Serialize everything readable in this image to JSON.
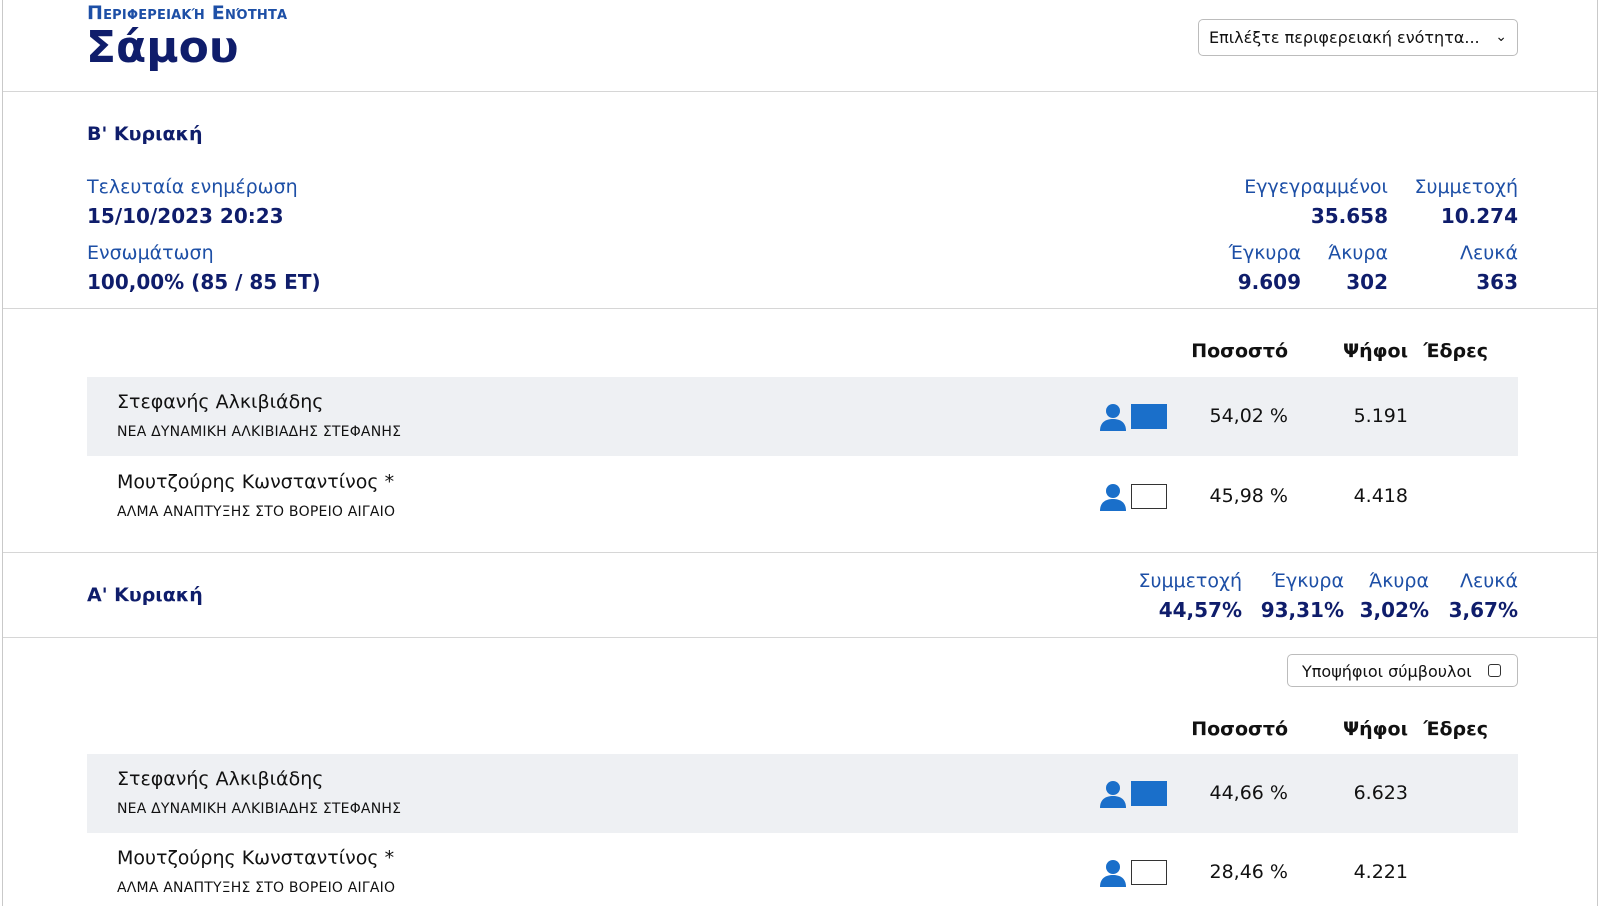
{
  "header": {
    "kicker": "Περιφερειακή Ενότητα",
    "title": "Σάμου",
    "region_select": {
      "value": "Επιλέξτε περιφερειακή ενότητα..."
    }
  },
  "round_b": {
    "title": "Β' Κυριακή",
    "last_update_label": "Τελευταία ενημέρωση",
    "last_update_value": "15/10/2023 20:23",
    "integration_label": "Ενσωμάτωση",
    "integration_value": "100,00% (85 / 85 ΕΤ)",
    "registered_label": "Εγγεγραμμένοι",
    "registered_value": "35.658",
    "turnout_label": "Συμμετοχή",
    "turnout_value": "10.274",
    "valid_label": "Έγκυρα",
    "valid_value": "9.609",
    "invalid_label": "Άκυρα",
    "invalid_value": "302",
    "blank_label": "Λευκά",
    "blank_value": "363",
    "columns": {
      "percent": "Ποσοστό",
      "votes": "Ψήφοι",
      "seats": "Έδρες"
    },
    "candidates": [
      {
        "name": "Στεφανής Αλκιβιάδης",
        "party": "ΝΕΑ ΔΥΝΑΜΙΚΗ ΑΛΚΙΒΙΑΔΗΣ ΣΤΕΦΑΝΗΣ",
        "percent": "54,02 %",
        "votes": "5.191",
        "seats": "",
        "color": "#1a6fca"
      },
      {
        "name": "Μουτζούρης Κωνσταντίνος *",
        "party": "ΑΛΜΑ ΑΝΑΠΤΥΞΗΣ ΣΤΟ ΒΟΡΕΙΟ ΑΙΓΑΙΟ",
        "percent": "45,98 %",
        "votes": "4.418",
        "seats": "",
        "color": "#ffffff"
      }
    ]
  },
  "round_a": {
    "title": "Α' Κυριακή",
    "turnout_label": "Συμμετοχή",
    "turnout_value": "44,57%",
    "valid_label": "Έγκυρα",
    "valid_value": "93,31%",
    "invalid_label": "Άκυρα",
    "invalid_value": "3,02%",
    "blank_label": "Λευκά",
    "blank_value": "3,67%",
    "councillors_toggle_label": "Υποψήφιοι σύμβουλοι",
    "columns": {
      "percent": "Ποσοστό",
      "votes": "Ψήφοι",
      "seats": "Έδρες"
    },
    "candidates": [
      {
        "name": "Στεφανής Αλκιβιάδης",
        "party": "ΝΕΑ ΔΥΝΑΜΙΚΗ ΑΛΚΙΒΙΑΔΗΣ ΣΤΕΦΑΝΗΣ",
        "percent": "44,66 %",
        "votes": "6.623",
        "seats": "",
        "color": "#1a6fca"
      },
      {
        "name": "Μουτζούρης Κωνσταντίνος *",
        "party": "ΑΛΜΑ ΑΝΑΠΤΥΞΗΣ ΣΤΟ ΒΟΡΕΙΟ ΑΙΓΑΙΟ",
        "percent": "28,46 %",
        "votes": "4.221",
        "seats": "",
        "color": "#ffffff"
      }
    ]
  }
}
